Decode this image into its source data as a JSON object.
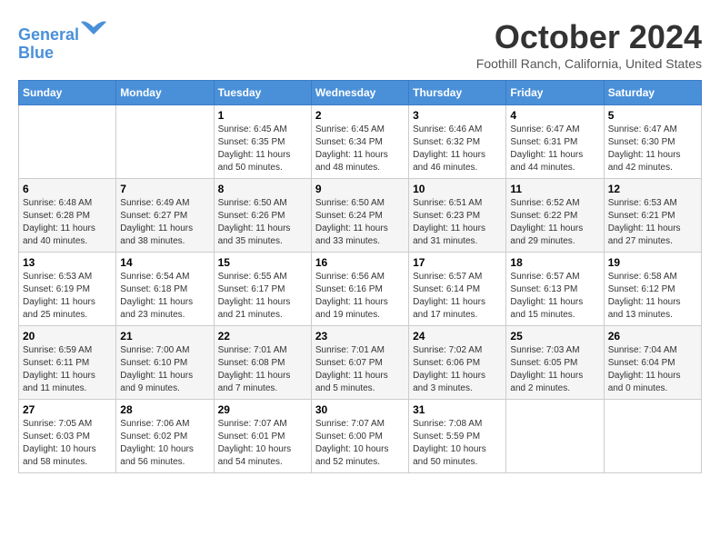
{
  "header": {
    "logo_line1": "General",
    "logo_line2": "Blue",
    "month": "October 2024",
    "location": "Foothill Ranch, California, United States"
  },
  "weekdays": [
    "Sunday",
    "Monday",
    "Tuesday",
    "Wednesday",
    "Thursday",
    "Friday",
    "Saturday"
  ],
  "weeks": [
    [
      {
        "day": "",
        "detail": ""
      },
      {
        "day": "",
        "detail": ""
      },
      {
        "day": "1",
        "detail": "Sunrise: 6:45 AM\nSunset: 6:35 PM\nDaylight: 11 hours and 50 minutes."
      },
      {
        "day": "2",
        "detail": "Sunrise: 6:45 AM\nSunset: 6:34 PM\nDaylight: 11 hours and 48 minutes."
      },
      {
        "day": "3",
        "detail": "Sunrise: 6:46 AM\nSunset: 6:32 PM\nDaylight: 11 hours and 46 minutes."
      },
      {
        "day": "4",
        "detail": "Sunrise: 6:47 AM\nSunset: 6:31 PM\nDaylight: 11 hours and 44 minutes."
      },
      {
        "day": "5",
        "detail": "Sunrise: 6:47 AM\nSunset: 6:30 PM\nDaylight: 11 hours and 42 minutes."
      }
    ],
    [
      {
        "day": "6",
        "detail": "Sunrise: 6:48 AM\nSunset: 6:28 PM\nDaylight: 11 hours and 40 minutes."
      },
      {
        "day": "7",
        "detail": "Sunrise: 6:49 AM\nSunset: 6:27 PM\nDaylight: 11 hours and 38 minutes."
      },
      {
        "day": "8",
        "detail": "Sunrise: 6:50 AM\nSunset: 6:26 PM\nDaylight: 11 hours and 35 minutes."
      },
      {
        "day": "9",
        "detail": "Sunrise: 6:50 AM\nSunset: 6:24 PM\nDaylight: 11 hours and 33 minutes."
      },
      {
        "day": "10",
        "detail": "Sunrise: 6:51 AM\nSunset: 6:23 PM\nDaylight: 11 hours and 31 minutes."
      },
      {
        "day": "11",
        "detail": "Sunrise: 6:52 AM\nSunset: 6:22 PM\nDaylight: 11 hours and 29 minutes."
      },
      {
        "day": "12",
        "detail": "Sunrise: 6:53 AM\nSunset: 6:21 PM\nDaylight: 11 hours and 27 minutes."
      }
    ],
    [
      {
        "day": "13",
        "detail": "Sunrise: 6:53 AM\nSunset: 6:19 PM\nDaylight: 11 hours and 25 minutes."
      },
      {
        "day": "14",
        "detail": "Sunrise: 6:54 AM\nSunset: 6:18 PM\nDaylight: 11 hours and 23 minutes."
      },
      {
        "day": "15",
        "detail": "Sunrise: 6:55 AM\nSunset: 6:17 PM\nDaylight: 11 hours and 21 minutes."
      },
      {
        "day": "16",
        "detail": "Sunrise: 6:56 AM\nSunset: 6:16 PM\nDaylight: 11 hours and 19 minutes."
      },
      {
        "day": "17",
        "detail": "Sunrise: 6:57 AM\nSunset: 6:14 PM\nDaylight: 11 hours and 17 minutes."
      },
      {
        "day": "18",
        "detail": "Sunrise: 6:57 AM\nSunset: 6:13 PM\nDaylight: 11 hours and 15 minutes."
      },
      {
        "day": "19",
        "detail": "Sunrise: 6:58 AM\nSunset: 6:12 PM\nDaylight: 11 hours and 13 minutes."
      }
    ],
    [
      {
        "day": "20",
        "detail": "Sunrise: 6:59 AM\nSunset: 6:11 PM\nDaylight: 11 hours and 11 minutes."
      },
      {
        "day": "21",
        "detail": "Sunrise: 7:00 AM\nSunset: 6:10 PM\nDaylight: 11 hours and 9 minutes."
      },
      {
        "day": "22",
        "detail": "Sunrise: 7:01 AM\nSunset: 6:08 PM\nDaylight: 11 hours and 7 minutes."
      },
      {
        "day": "23",
        "detail": "Sunrise: 7:01 AM\nSunset: 6:07 PM\nDaylight: 11 hours and 5 minutes."
      },
      {
        "day": "24",
        "detail": "Sunrise: 7:02 AM\nSunset: 6:06 PM\nDaylight: 11 hours and 3 minutes."
      },
      {
        "day": "25",
        "detail": "Sunrise: 7:03 AM\nSunset: 6:05 PM\nDaylight: 11 hours and 2 minutes."
      },
      {
        "day": "26",
        "detail": "Sunrise: 7:04 AM\nSunset: 6:04 PM\nDaylight: 11 hours and 0 minutes."
      }
    ],
    [
      {
        "day": "27",
        "detail": "Sunrise: 7:05 AM\nSunset: 6:03 PM\nDaylight: 10 hours and 58 minutes."
      },
      {
        "day": "28",
        "detail": "Sunrise: 7:06 AM\nSunset: 6:02 PM\nDaylight: 10 hours and 56 minutes."
      },
      {
        "day": "29",
        "detail": "Sunrise: 7:07 AM\nSunset: 6:01 PM\nDaylight: 10 hours and 54 minutes."
      },
      {
        "day": "30",
        "detail": "Sunrise: 7:07 AM\nSunset: 6:00 PM\nDaylight: 10 hours and 52 minutes."
      },
      {
        "day": "31",
        "detail": "Sunrise: 7:08 AM\nSunset: 5:59 PM\nDaylight: 10 hours and 50 minutes."
      },
      {
        "day": "",
        "detail": ""
      },
      {
        "day": "",
        "detail": ""
      }
    ]
  ]
}
